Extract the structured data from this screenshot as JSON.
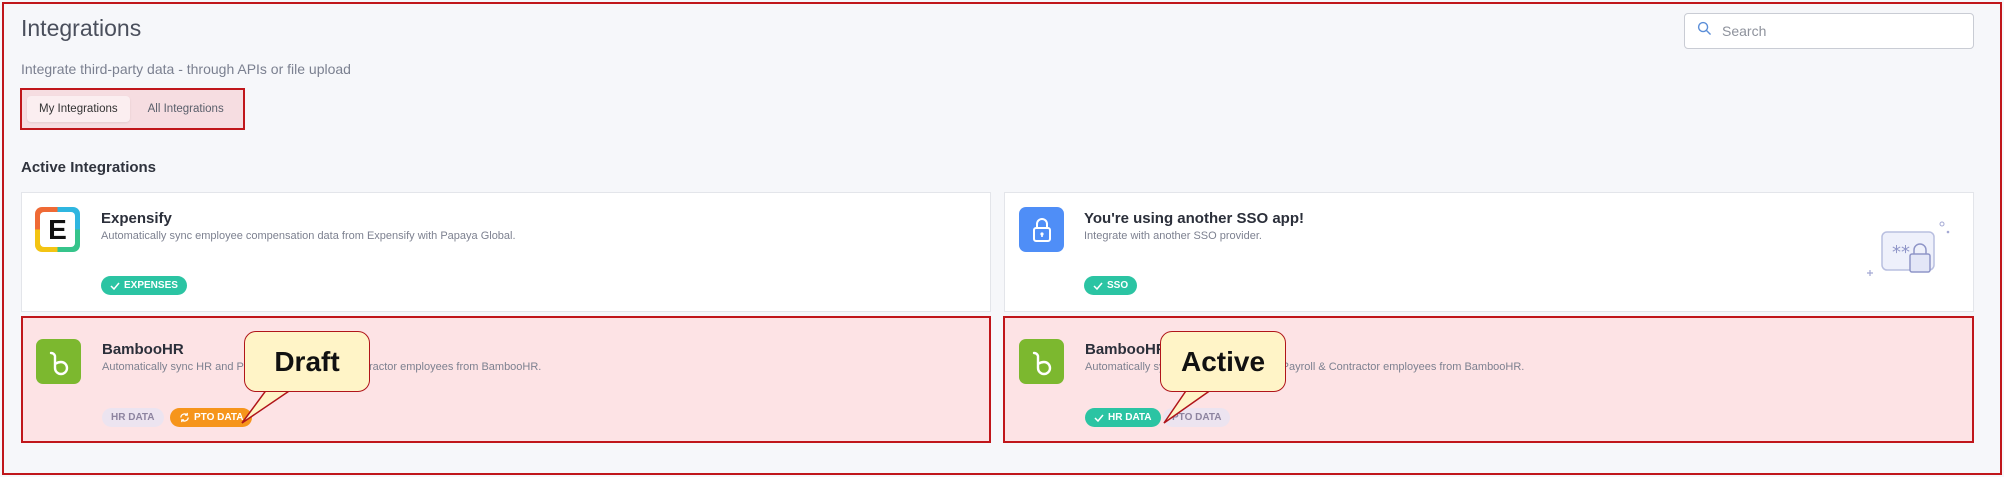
{
  "header": {
    "title": "Integrations",
    "subtitle": "Integrate third-party data - through APIs or file upload"
  },
  "search": {
    "placeholder": "Search",
    "value": ""
  },
  "tabs": [
    {
      "label": "My Integrations",
      "active": true
    },
    {
      "label": "All Integrations",
      "active": false
    }
  ],
  "section": {
    "title": "Active Integrations"
  },
  "cards": {
    "expensify": {
      "title": "Expensify",
      "description": "Automatically sync employee compensation data from Expensify with Papaya Global.",
      "logo_letter": "E",
      "tag": "EXPENSES"
    },
    "sso": {
      "title": "You're using another SSO app!",
      "description": "Integrate with another SSO provider.",
      "tag": "SSO"
    },
    "bamboo_draft": {
      "title": "BambooHR",
      "description": "Automatically sync HR and PTO data of Payroll & Contractor employees from BambooHR.",
      "tags": [
        "HR DATA",
        "PTO DATA"
      ]
    },
    "bamboo_active": {
      "title": "BambooHR",
      "description": "Automatically sync HR and PTO data of Payroll & Contractor employees from BambooHR.",
      "tags": [
        "HR DATA",
        "PTO DATA"
      ]
    }
  },
  "callouts": {
    "draft": "Draft",
    "active": "Active"
  },
  "colors": {
    "highlight_border": "#c0161b",
    "highlight_fill": "#fde3e5",
    "tag_green": "#2bc4a3",
    "tag_orange": "#f6951b",
    "bamboo_green": "#7cb82f",
    "sso_blue": "#4f8ef7",
    "callout_fill": "#fff4c7"
  },
  "icons": [
    "search-icon",
    "check-icon",
    "sync-icon",
    "lock-icon",
    "bamboohr-logo-icon",
    "expensify-logo-icon",
    "sso-illustration-icon"
  ]
}
